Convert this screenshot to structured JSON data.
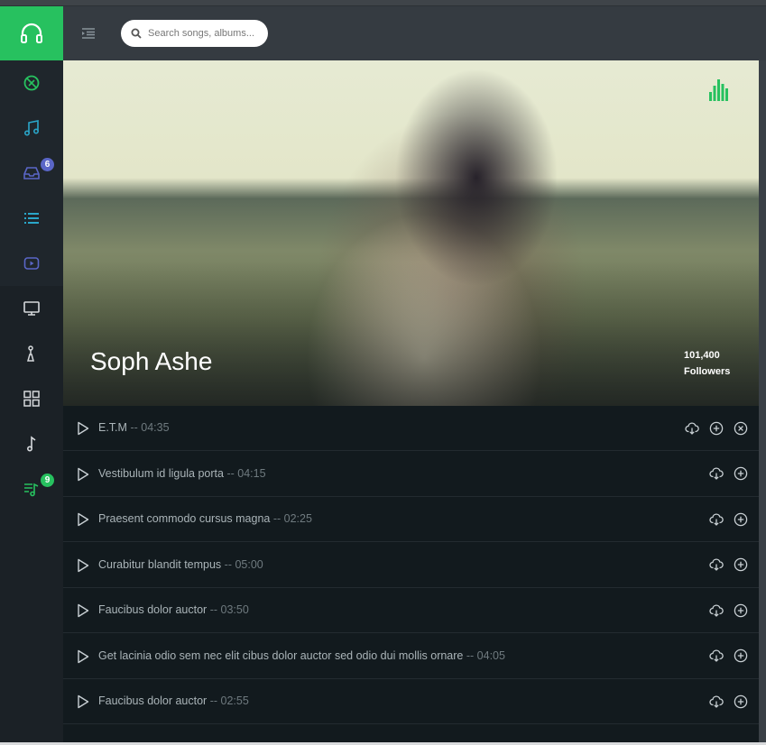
{
  "search": {
    "placeholder": "Search songs, albums..."
  },
  "sidebar": {
    "items": [
      {
        "icon": "compass-icon",
        "color": "#27c15f"
      },
      {
        "icon": "music-notes-icon",
        "color": "#2aa6c9"
      },
      {
        "icon": "inbox-icon",
        "color": "#5a66c7",
        "badge": "6",
        "badge_color": "#5a66c7"
      },
      {
        "icon": "list-icon",
        "color": "#2aa6c9"
      },
      {
        "icon": "video-icon",
        "color": "#5a66c7"
      },
      {
        "icon": "monitor-icon",
        "color": "#d6d9dc"
      },
      {
        "icon": "microphone-icon",
        "color": "#d6d9dc"
      },
      {
        "icon": "grid-icon",
        "color": "#d6d9dc"
      },
      {
        "icon": "music-note-icon",
        "color": "#d6d9dc"
      },
      {
        "icon": "playlist-icon",
        "color": "#27c15f",
        "badge": "9",
        "badge_color": "#27c15f"
      }
    ]
  },
  "hero": {
    "artist_name": "Soph Ashe",
    "followers_count": "101,400",
    "followers_label": "Followers"
  },
  "tracks": [
    {
      "title": "E.T.M",
      "duration": "-- 04:35",
      "actions": [
        "download",
        "add",
        "remove"
      ]
    },
    {
      "title": "Vestibulum id ligula porta",
      "duration": "-- 04:15",
      "actions": [
        "download",
        "add"
      ]
    },
    {
      "title": "Praesent commodo cursus magna",
      "duration": "-- 02:25",
      "actions": [
        "download",
        "add"
      ]
    },
    {
      "title": "Curabitur blandit tempus",
      "duration": "-- 05:00",
      "actions": [
        "download",
        "add"
      ]
    },
    {
      "title": "Faucibus dolor auctor",
      "duration": "-- 03:50",
      "actions": [
        "download",
        "add"
      ]
    },
    {
      "title": "Get lacinia odio sem nec elit cibus dolor auctor sed odio dui mollis ornare",
      "duration": "-- 04:05",
      "actions": [
        "download",
        "add"
      ]
    },
    {
      "title": "Faucibus dolor auctor",
      "duration": "-- 02:55",
      "actions": [
        "download",
        "add"
      ]
    }
  ],
  "colors": {
    "accent": "#27c15f",
    "sidebar_bg": "#1b2126",
    "header_bg": "#353b41",
    "track_bg": "#121a1e"
  }
}
